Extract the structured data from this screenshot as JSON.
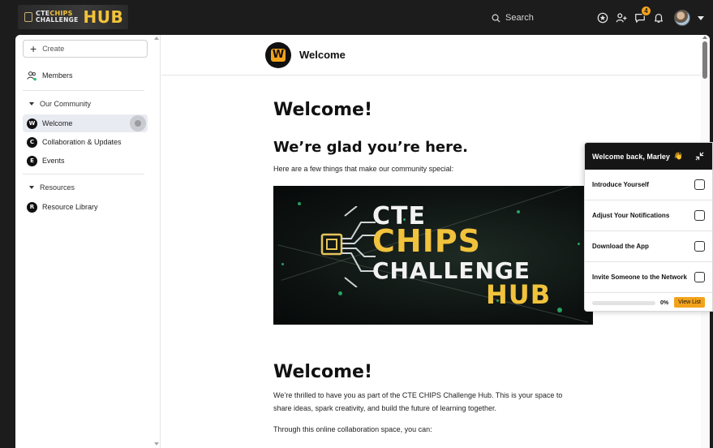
{
  "header": {
    "logo": {
      "cte": "CTE",
      "chips": "CHIPS",
      "challenge": "CHALLENGE",
      "hub": "HUB"
    },
    "search_label": "Search",
    "notification_count": "4",
    "icons": [
      "star-icon",
      "add-person-icon",
      "chat-icon",
      "bell-icon"
    ]
  },
  "sidebar": {
    "create_label": "Create",
    "members_label": "Members",
    "sections": [
      {
        "title": "Our Community",
        "items": [
          {
            "label": "Welcome",
            "icon": "W",
            "active": true
          },
          {
            "label": "Collaboration & Updates",
            "icon": "C"
          },
          {
            "label": "Events",
            "icon": "E"
          }
        ]
      },
      {
        "title": "Resources",
        "items": [
          {
            "label": "Resource Library",
            "icon": "R"
          }
        ]
      }
    ]
  },
  "content": {
    "header_title": "Welcome",
    "logo_letter": "W",
    "heading1": "Welcome!",
    "heading2": "We’re glad you’re here.",
    "intro": "Here are a few things that make our community special:",
    "banner": {
      "line1": "CTE",
      "line2": "CHIPS",
      "line3": "CHALLENGE",
      "line4": "HUB"
    },
    "heading3": "Welcome!",
    "para1_line1": "We’re thrilled to have you as part of the CTE CHIPS Challenge Hub. This is your space to",
    "para1_line2": "share ideas, spark creativity, and build the future of learning together.",
    "para2": "Through this online collaboration space, you can:"
  },
  "widget": {
    "title": "Welcome back, Marley",
    "wave": "👋",
    "tasks": [
      {
        "label": "Introduce Yourself",
        "done": false
      },
      {
        "label": "Adjust Your Notifications",
        "done": false
      },
      {
        "label": "Download the App",
        "done": false
      },
      {
        "label": "Invite Someone to the Network",
        "done": false
      }
    ],
    "progress_percent": 0,
    "progress_label": "0%",
    "view_list_label": "View List"
  },
  "colors": {
    "accent": "#f3a31b",
    "gold": "#f3c33a",
    "dark": "#1c1c1c",
    "active_bg": "#e9ebf2"
  }
}
